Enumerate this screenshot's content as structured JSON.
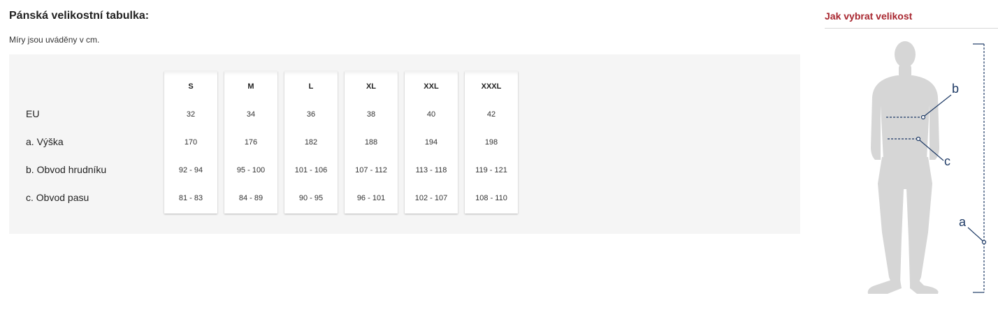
{
  "main": {
    "title": "Pánská velikostní tabulka:",
    "subtitle": "Míry jsou uváděny v cm."
  },
  "table": {
    "row_labels": [
      "EU",
      "a. Výška",
      "b. Obvod hrudníku",
      "c. Obvod pasu"
    ],
    "columns": [
      {
        "size": "S",
        "eu": "32",
        "height": "170",
        "chest": "92 - 94",
        "waist": "81 - 83"
      },
      {
        "size": "M",
        "eu": "34",
        "height": "176",
        "chest": "95 - 100",
        "waist": "84 - 89"
      },
      {
        "size": "L",
        "eu": "36",
        "height": "182",
        "chest": "101 - 106",
        "waist": "90 - 95"
      },
      {
        "size": "XL",
        "eu": "38",
        "height": "188",
        "chest": "107 - 112",
        "waist": "96 - 101"
      },
      {
        "size": "XXL",
        "eu": "40",
        "height": "194",
        "chest": "113 - 118",
        "waist": "102 - 107"
      },
      {
        "size": "XXXL",
        "eu": "42",
        "height": "198",
        "chest": "119 - 121",
        "waist": "108 - 110"
      }
    ]
  },
  "sidebar": {
    "title": "Jak vybrat velikost",
    "labels": {
      "a": "a",
      "b": "b",
      "c": "c"
    },
    "title_color": "#a8262f",
    "line_color": "#1f3b66"
  }
}
